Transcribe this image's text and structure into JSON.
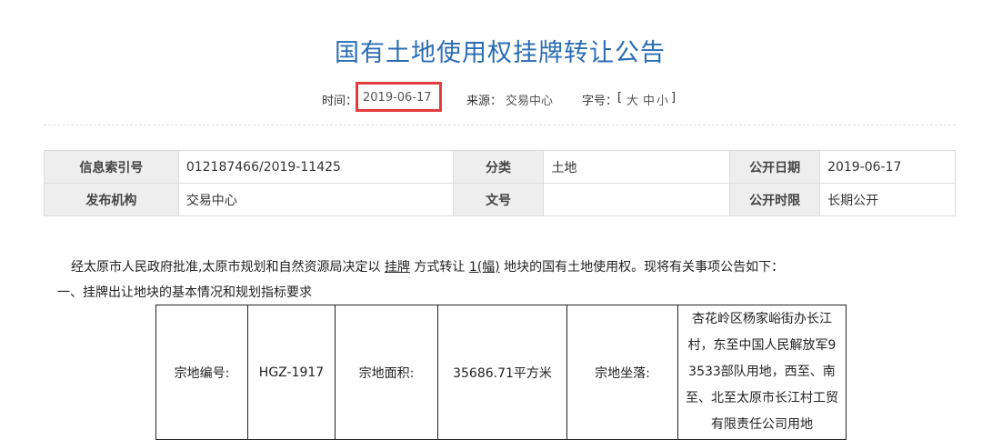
{
  "page": {
    "title": "国有土地使用权挂牌转让公告",
    "meta": {
      "time_label": "时间：",
      "time_value": "2019-06-17",
      "source_label": "来源：",
      "source_value": "交易中心",
      "fontsize_label": "字号：",
      "fontsize_open": "[",
      "fontsize_large": "大",
      "fontsize_medium": "中",
      "fontsize_small": "小",
      "fontsize_close": "]"
    },
    "highlight_color": "#e23c3c",
    "title_color": "#2a6db5"
  },
  "info": {
    "index_label": "信息索引号",
    "index_value": "012187466/2019-11425",
    "category_label": "分类",
    "category_value": "土地",
    "open_date_label": "公开日期",
    "open_date_value": "2019-06-17",
    "publisher_label": "发布机构",
    "publisher_value": "交易中心",
    "doc_no_label": "文号",
    "doc_no_value": "",
    "open_term_label": "公开时限",
    "open_term_value": "长期公开"
  },
  "body": {
    "para_part1": "经太原市人民政府批准,太原市规划和自然资源局决定以 ",
    "para_method": "挂牌",
    "para_part2": " 方式转让 ",
    "para_count": "1(幅)",
    "para_part3": " 地块的国有土地使用权。现将有关事项公告如下：",
    "section1": "一、挂牌出让地块的基本情况和规划指标要求"
  },
  "parcel": {
    "no_label": "宗地编号:",
    "no_value": "HGZ-1917",
    "area_label": "宗地面积:",
    "area_value": "35686.71平方米",
    "location_label": "宗地坐落:",
    "location_lines": [
      "杏花岭区杨家峪街办长江",
      "村，东至中国人民解放军9",
      "3533部队用地，西至、南",
      "至、北至太原市长江村工贸",
      "有限责任公司用地"
    ]
  }
}
